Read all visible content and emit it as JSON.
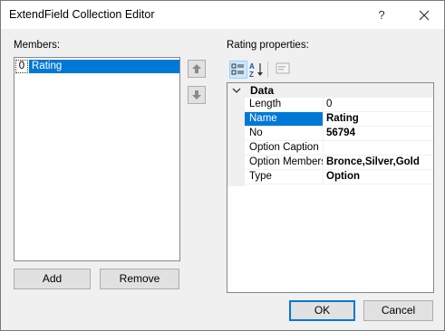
{
  "window": {
    "title": "ExtendField Collection Editor",
    "help_glyph": "?"
  },
  "members": {
    "label": "Members:",
    "items": [
      {
        "index": "0",
        "name": "Rating",
        "selected": true
      }
    ],
    "add_label": "Add",
    "remove_label": "Remove"
  },
  "properties": {
    "label": "Rating properties:",
    "toolbar": {
      "categorized_icon": "categorized-icon",
      "alphabetical_icon": "alphabetical-icon",
      "property_pages_icon": "property-pages-icon"
    },
    "category": "Data",
    "rows": [
      {
        "name": "Length",
        "value": "0",
        "bold": false,
        "selected": false
      },
      {
        "name": "Name",
        "value": "Rating",
        "bold": true,
        "selected": true
      },
      {
        "name": "No",
        "value": "56794",
        "bold": true,
        "selected": false
      },
      {
        "name": "Option Caption",
        "value": "",
        "bold": false,
        "selected": false
      },
      {
        "name": "Option Members",
        "value": "Bronce,Silver,Gold",
        "bold": true,
        "selected": false
      },
      {
        "name": "Type",
        "value": "Option",
        "bold": true,
        "selected": false
      }
    ]
  },
  "footer": {
    "ok_label": "OK",
    "cancel_label": "Cancel"
  },
  "colors": {
    "selection": "#0078d7",
    "background": "#f0f0f0"
  }
}
